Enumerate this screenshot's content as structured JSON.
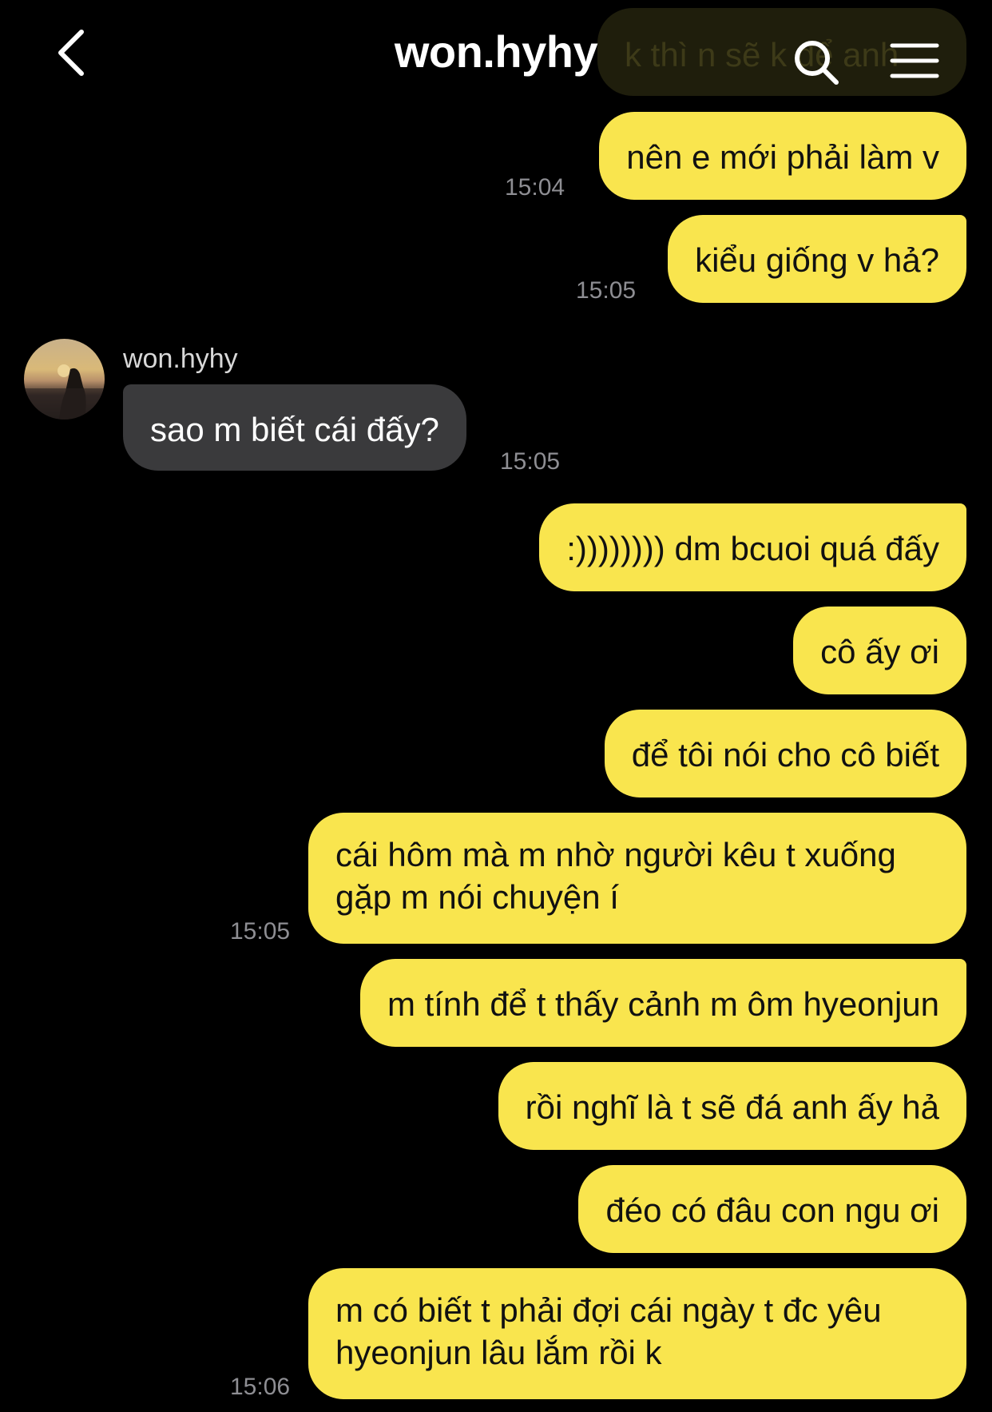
{
  "header": {
    "back_icon": "chevron-left-icon",
    "title": "won.hyhy",
    "search_icon": "search-icon",
    "menu_icon": "hamburger-menu-icon"
  },
  "partial_top_message": "k thì n sẽ k để anh",
  "contact": {
    "name": "won.hyhy",
    "avatar": "avatar"
  },
  "messages": [
    {
      "from": "me",
      "text": "nên e mới phải làm v",
      "time": "15:04"
    },
    {
      "from": "me",
      "text": "kiểu giống v hả?",
      "time": "15:05"
    },
    {
      "from": "them",
      "text": "sao m biết cái đấy?",
      "time": "15:05"
    },
    {
      "from": "me",
      "text": ":)))))))) dm bcuoi quá đấy"
    },
    {
      "from": "me",
      "text": "cô ấy ơi"
    },
    {
      "from": "me",
      "text": "để tôi nói cho cô biết"
    },
    {
      "from": "me",
      "line1": "cái hôm mà m nhờ người kêu t xuống",
      "line2": "gặp m nói chuyện í",
      "time": "15:05"
    },
    {
      "from": "me",
      "text": "m tính để t thấy cảnh m ôm hyeonjun"
    },
    {
      "from": "me",
      "text": "rồi nghĩ là t sẽ đá anh ấy hả"
    },
    {
      "from": "me",
      "text": "đéo có đâu con ngu ơi"
    },
    {
      "from": "me",
      "line1": "m có biết t phải đợi cái ngày t đc yêu",
      "line2": "hyeonjun lâu lắm rồi k",
      "time": "15:06"
    }
  ],
  "colors": {
    "my_bubble": "#f9e54e",
    "their_bubble": "#3a3a3c",
    "background": "#000000",
    "time": "#8e8e93"
  }
}
